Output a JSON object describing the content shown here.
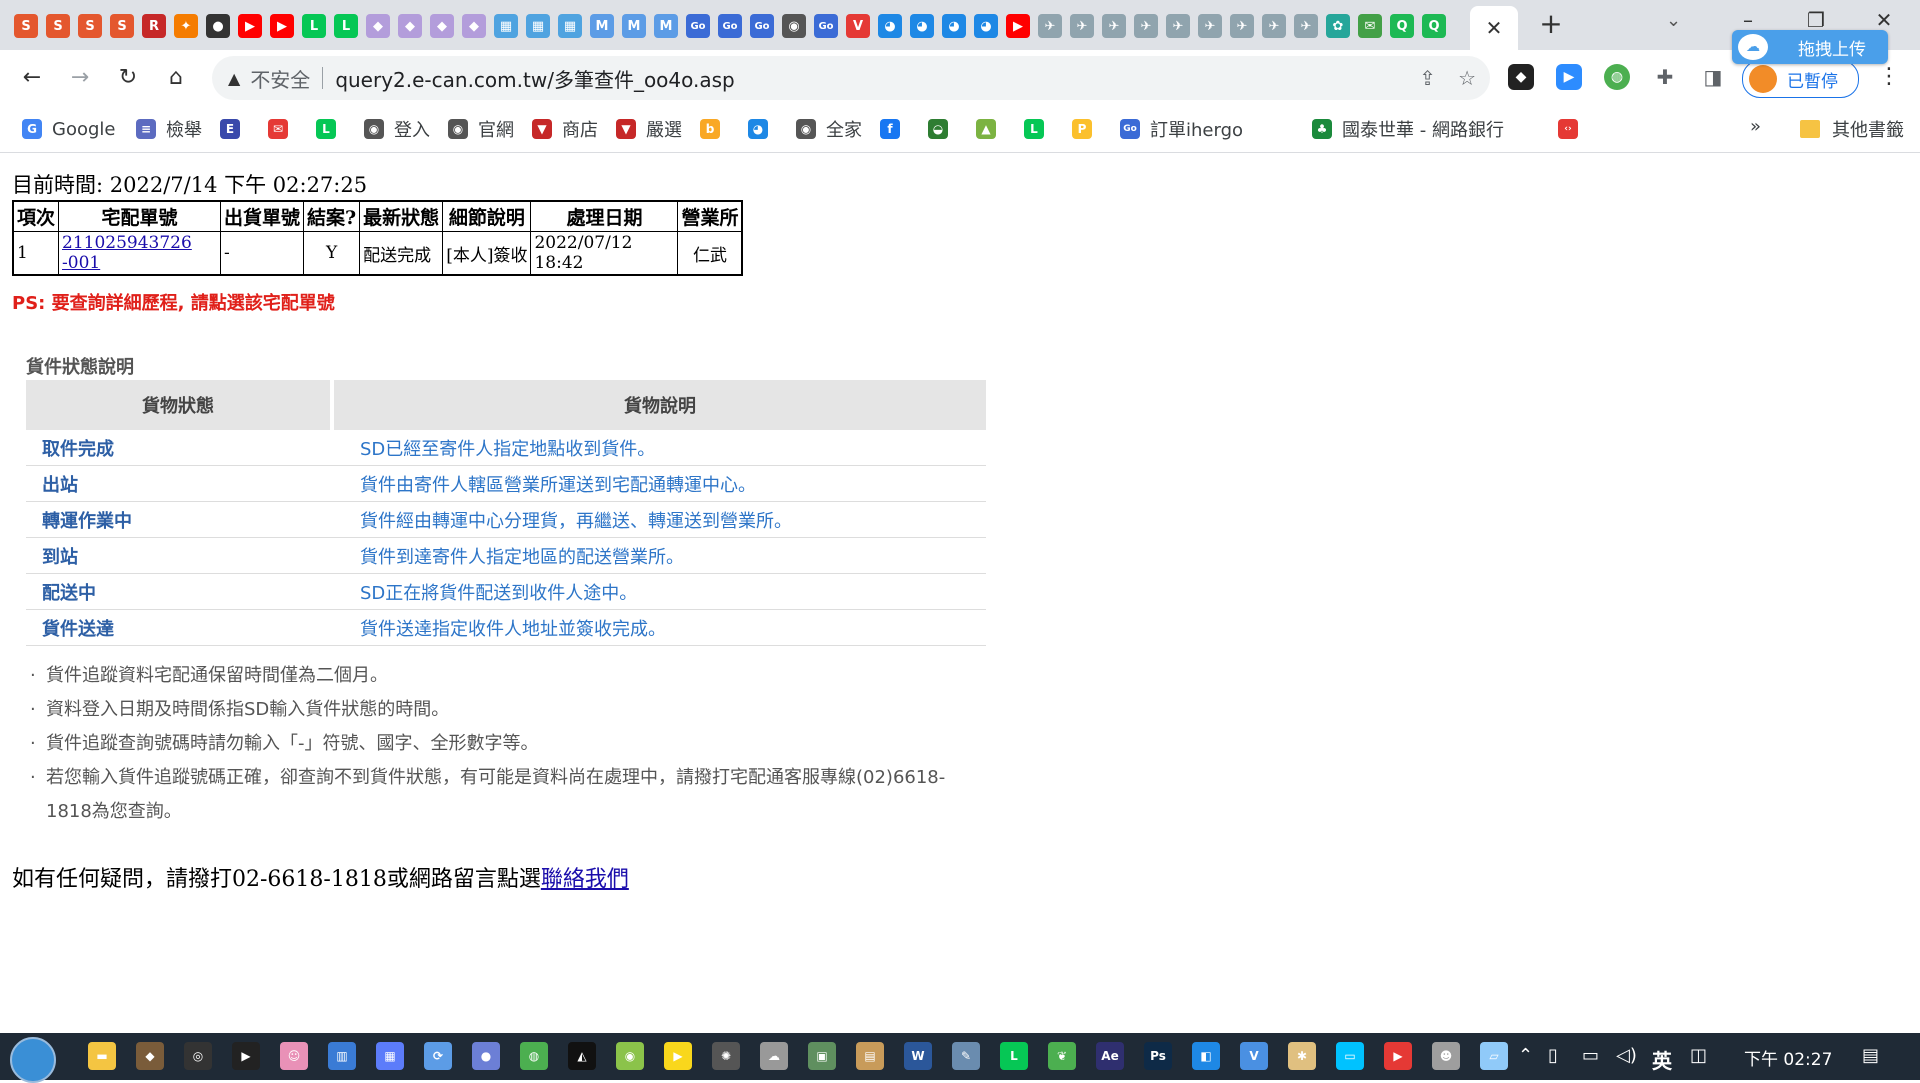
{
  "browser": {
    "url": "query2.e-can.com.tw/多筆查件_oo4o.asp",
    "security_label": "不安全",
    "profile_label": "已暫停",
    "baidu_overlay_label": "拖拽上传"
  },
  "tab_icons": [
    {
      "name": "s-icon",
      "color": "#e4572e",
      "glyph": "S"
    },
    {
      "name": "s-icon",
      "color": "#e4572e",
      "glyph": "S"
    },
    {
      "name": "s-icon",
      "color": "#e4572e",
      "glyph": "S"
    },
    {
      "name": "s-icon",
      "color": "#e4572e",
      "glyph": "S"
    },
    {
      "name": "r-icon",
      "color": "#c62828",
      "glyph": "R"
    },
    {
      "name": "orange-icon",
      "color": "#f57c00",
      "glyph": "✦"
    },
    {
      "name": "dark-circle-icon",
      "color": "#333333",
      "glyph": "●"
    },
    {
      "name": "youtube-icon",
      "color": "#ff0000",
      "glyph": "▶"
    },
    {
      "name": "youtube-icon",
      "color": "#ff0000",
      "glyph": "▶"
    },
    {
      "name": "line-icon",
      "color": "#06c755",
      "glyph": "L"
    },
    {
      "name": "line-icon",
      "color": "#06c755",
      "glyph": "L"
    },
    {
      "name": "purple-icon",
      "color": "#b39ddb",
      "glyph": "◆"
    },
    {
      "name": "purple-icon",
      "color": "#b39ddb",
      "glyph": "◆"
    },
    {
      "name": "purple-icon",
      "color": "#b39ddb",
      "glyph": "◆"
    },
    {
      "name": "purple-icon",
      "color": "#b39ddb",
      "glyph": "◆"
    },
    {
      "name": "calendar-icon",
      "color": "#4fa3e0",
      "glyph": "▦"
    },
    {
      "name": "calendar-icon",
      "color": "#4fa3e0",
      "glyph": "▦"
    },
    {
      "name": "calendar-icon",
      "color": "#4fa3e0",
      "glyph": "▦"
    },
    {
      "name": "m-icon",
      "color": "#5c9ce6",
      "glyph": "M"
    },
    {
      "name": "m-icon",
      "color": "#5c9ce6",
      "glyph": "M"
    },
    {
      "name": "m-icon",
      "color": "#5c9ce6",
      "glyph": "M"
    },
    {
      "name": "go-icon",
      "color": "#3b6bd6",
      "glyph": "Go"
    },
    {
      "name": "go-icon",
      "color": "#3b6bd6",
      "glyph": "Go"
    },
    {
      "name": "go-icon",
      "color": "#3b6bd6",
      "glyph": "Go"
    },
    {
      "name": "globe-icon",
      "color": "#555555",
      "glyph": "◉"
    },
    {
      "name": "go-icon",
      "color": "#3b6bd6",
      "glyph": "Go"
    },
    {
      "name": "v-icon",
      "color": "#e53935",
      "glyph": "V"
    },
    {
      "name": "bird-icon",
      "color": "#1e88e5",
      "glyph": "◕"
    },
    {
      "name": "bird-icon",
      "color": "#1e88e5",
      "glyph": "◕"
    },
    {
      "name": "bird-icon",
      "color": "#1e88e5",
      "glyph": "◕"
    },
    {
      "name": "bird-icon",
      "color": "#1e88e5",
      "glyph": "◕"
    },
    {
      "name": "youtube-icon",
      "color": "#ff0000",
      "glyph": "▶"
    },
    {
      "name": "plane-icon",
      "color": "#90a4ae",
      "glyph": "✈"
    },
    {
      "name": "plane-icon",
      "color": "#90a4ae",
      "glyph": "✈"
    },
    {
      "name": "plane-icon",
      "color": "#90a4ae",
      "glyph": "✈"
    },
    {
      "name": "plane-icon",
      "color": "#90a4ae",
      "glyph": "✈"
    },
    {
      "name": "plane-icon",
      "color": "#90a4ae",
      "glyph": "✈"
    },
    {
      "name": "plane-icon",
      "color": "#90a4ae",
      "glyph": "✈"
    },
    {
      "name": "plane-icon",
      "color": "#90a4ae",
      "glyph": "✈"
    },
    {
      "name": "plane-icon",
      "color": "#90a4ae",
      "glyph": "✈"
    },
    {
      "name": "plane-icon",
      "color": "#90a4ae",
      "glyph": "✈"
    },
    {
      "name": "pinwheel-icon",
      "color": "#26a69a",
      "glyph": "✿"
    },
    {
      "name": "mail-icon",
      "color": "#43a047",
      "glyph": "✉"
    },
    {
      "name": "q-icon",
      "color": "#1db954",
      "glyph": "Q"
    },
    {
      "name": "q-icon",
      "color": "#1db954",
      "glyph": "Q"
    }
  ],
  "bookmarks": [
    {
      "name": "google",
      "label": "Google",
      "icon": "G",
      "color": "#4285f4"
    },
    {
      "name": "checklist",
      "label": "檢舉",
      "icon": "≡",
      "color": "#5c6bc0"
    },
    {
      "name": "e",
      "label": "",
      "icon": "E",
      "color": "#3949ab"
    },
    {
      "name": "mail",
      "label": "",
      "icon": "✉",
      "color": "#e53935"
    },
    {
      "name": "line",
      "label": "",
      "icon": "L",
      "color": "#06c755"
    },
    {
      "name": "login",
      "label": "登入",
      "icon": "◉",
      "color": "#555555"
    },
    {
      "name": "official",
      "label": "官網",
      "icon": "◉",
      "color": "#555555"
    },
    {
      "name": "shop",
      "label": "商店",
      "icon": "▼",
      "color": "#c62828"
    },
    {
      "name": "select",
      "label": "嚴選",
      "icon": "▼",
      "color": "#c62828"
    },
    {
      "name": "b",
      "label": "",
      "icon": "b",
      "color": "#f9a825"
    },
    {
      "name": "bird",
      "label": "",
      "icon": "◕",
      "color": "#1e88e5"
    },
    {
      "name": "familymart",
      "label": "全家",
      "icon": "◉",
      "color": "#555555"
    },
    {
      "name": "facebook",
      "label": "",
      "icon": "f",
      "color": "#1877f2"
    },
    {
      "name": "green",
      "label": "",
      "icon": "◒",
      "color": "#2e7d32"
    },
    {
      "name": "chart",
      "label": "",
      "icon": "▲",
      "color": "#7cb342"
    },
    {
      "name": "line-shield",
      "label": "",
      "icon": "L",
      "color": "#06c755"
    },
    {
      "name": "p",
      "label": "",
      "icon": "P",
      "color": "#fbc02d"
    },
    {
      "name": "ihergo",
      "label": "訂單ihergo",
      "icon": "Go",
      "color": "#3b6bd6"
    },
    {
      "name": "cathay",
      "label": "國泰世華 - 網路銀行",
      "icon": "♣",
      "color": "#1b8a3c"
    },
    {
      "name": "code",
      "label": "",
      "icon": "‹›",
      "color": "#e53935"
    }
  ],
  "bookmarks_more": "»",
  "bookmarks_other": "其他書籤",
  "page": {
    "current_time": "目前時間: 2022/7/14 下午 02:27:25",
    "table_headers": [
      "項次",
      "宅配單號",
      "出貨單號",
      "結案?",
      "最新狀態",
      "細節說明",
      "處理日期",
      "營業所"
    ],
    "rows": [
      {
        "no": "1",
        "tracking": "211025943726 -001",
        "ship": "-",
        "closed": "Y",
        "status": "配送完成",
        "detail": "[本人]簽收",
        "date": "2022/07/12 18:42",
        "office": "仁武"
      }
    ],
    "ps_note": "PS: 要查詢詳細歷程, 請點選該宅配單號",
    "status_title": "貨件狀態說明",
    "status_headers": [
      "貨物狀態",
      "貨物說明"
    ],
    "status_rows": [
      {
        "state": "取件完成",
        "desc": "SD已經至寄件人指定地點收到貨件。"
      },
      {
        "state": "出站",
        "desc": "貨件由寄件人轄區營業所運送到宅配通轉運中心。"
      },
      {
        "state": "轉運作業中",
        "desc": "貨件經由轉運中心分理貨，再繼送、轉運送到營業所。"
      },
      {
        "state": "到站",
        "desc": "貨件到達寄件人指定地區的配送營業所。"
      },
      {
        "state": "配送中",
        "desc": "SD正在將貨件配送到收件人途中。"
      },
      {
        "state": "貨件送達",
        "desc": "貨件送達指定收件人地址並簽收完成。"
      }
    ],
    "notes": [
      "貨件追蹤資料宅配通保留時間僅為二個月。",
      "資料登入日期及時間係指SD輸入貨件狀態的時間。",
      "貨件追蹤查詢號碼時請勿輸入「-」符號、國字、全形數字等。",
      "若您輸入貨件追蹤號碼正確，卻查詢不到貨件狀態，有可能是資料尚在處理中，請撥打宅配通客服專線(02)6618-1818為您查詢。"
    ],
    "contact_text": "如有任何疑問，請撥打02-6618-1818或網路留言點選",
    "contact_link": "聯絡我們"
  },
  "taskbar": {
    "ime": "英",
    "time": "下午 02:27",
    "icons": [
      {
        "name": "file-explorer-icon",
        "color": "#f4c542",
        "glyph": "▬"
      },
      {
        "name": "app-icon",
        "color": "#7a5c3a",
        "glyph": "◆"
      },
      {
        "name": "obs-icon",
        "color": "#333333",
        "glyph": "◎"
      },
      {
        "name": "media-icon",
        "color": "#222222",
        "glyph": "▶"
      },
      {
        "name": "anime-icon",
        "color": "#e991b7",
        "glyph": "☺"
      },
      {
        "name": "chart-icon",
        "color": "#3a7bd5",
        "glyph": "▥"
      },
      {
        "name": "grid-icon",
        "color": "#5c7cfa",
        "glyph": "▦"
      },
      {
        "name": "refresh-icon",
        "color": "#5c9ce6",
        "glyph": "⟳"
      },
      {
        "name": "bubble-icon",
        "color": "#6c7fd6",
        "glyph": "●"
      },
      {
        "name": "chrome-icon",
        "color": "#4caf50",
        "glyph": "◍"
      },
      {
        "name": "penguin-icon",
        "color": "#111111",
        "glyph": "◭"
      },
      {
        "name": "green-app-icon",
        "color": "#8bc34a",
        "glyph": "◉"
      },
      {
        "name": "yellow-play-icon",
        "color": "#f9d71c",
        "glyph": "▶"
      },
      {
        "name": "openai-icon",
        "color": "#555555",
        "glyph": "✺"
      },
      {
        "name": "cloud-icon",
        "color": "#999999",
        "glyph": "☁"
      },
      {
        "name": "photo-icon",
        "color": "#5f8f5f",
        "glyph": "▣"
      },
      {
        "name": "book-icon",
        "color": "#c89b5a",
        "glyph": "▤"
      },
      {
        "name": "word-icon",
        "color": "#2b579a",
        "glyph": "W"
      },
      {
        "name": "brush-icon",
        "color": "#6a8caf",
        "glyph": "✎"
      },
      {
        "name": "line-icon",
        "color": "#06c755",
        "glyph": "L"
      },
      {
        "name": "leaf-icon",
        "color": "#4caf50",
        "glyph": "❦"
      },
      {
        "name": "after-effects-icon",
        "color": "#2f2f6f",
        "glyph": "Ae"
      },
      {
        "name": "photoshop-icon",
        "color": "#0e2a47",
        "glyph": "Ps"
      },
      {
        "name": "video-icon",
        "color": "#1e88e5",
        "glyph": "◧"
      },
      {
        "name": "v-shield-icon",
        "color": "#4a90e2",
        "glyph": "V"
      },
      {
        "name": "pinwheel-icon",
        "color": "#e0c080",
        "glyph": "✱"
      },
      {
        "name": "monitor-icon",
        "color": "#00c2ff",
        "glyph": "▭"
      },
      {
        "name": "flag-icon",
        "color": "#e53935",
        "glyph": "▶"
      },
      {
        "name": "user-icon",
        "color": "#9e9e9e",
        "glyph": "☻"
      },
      {
        "name": "notes-icon",
        "color": "#90caf9",
        "glyph": "▱"
      }
    ]
  }
}
